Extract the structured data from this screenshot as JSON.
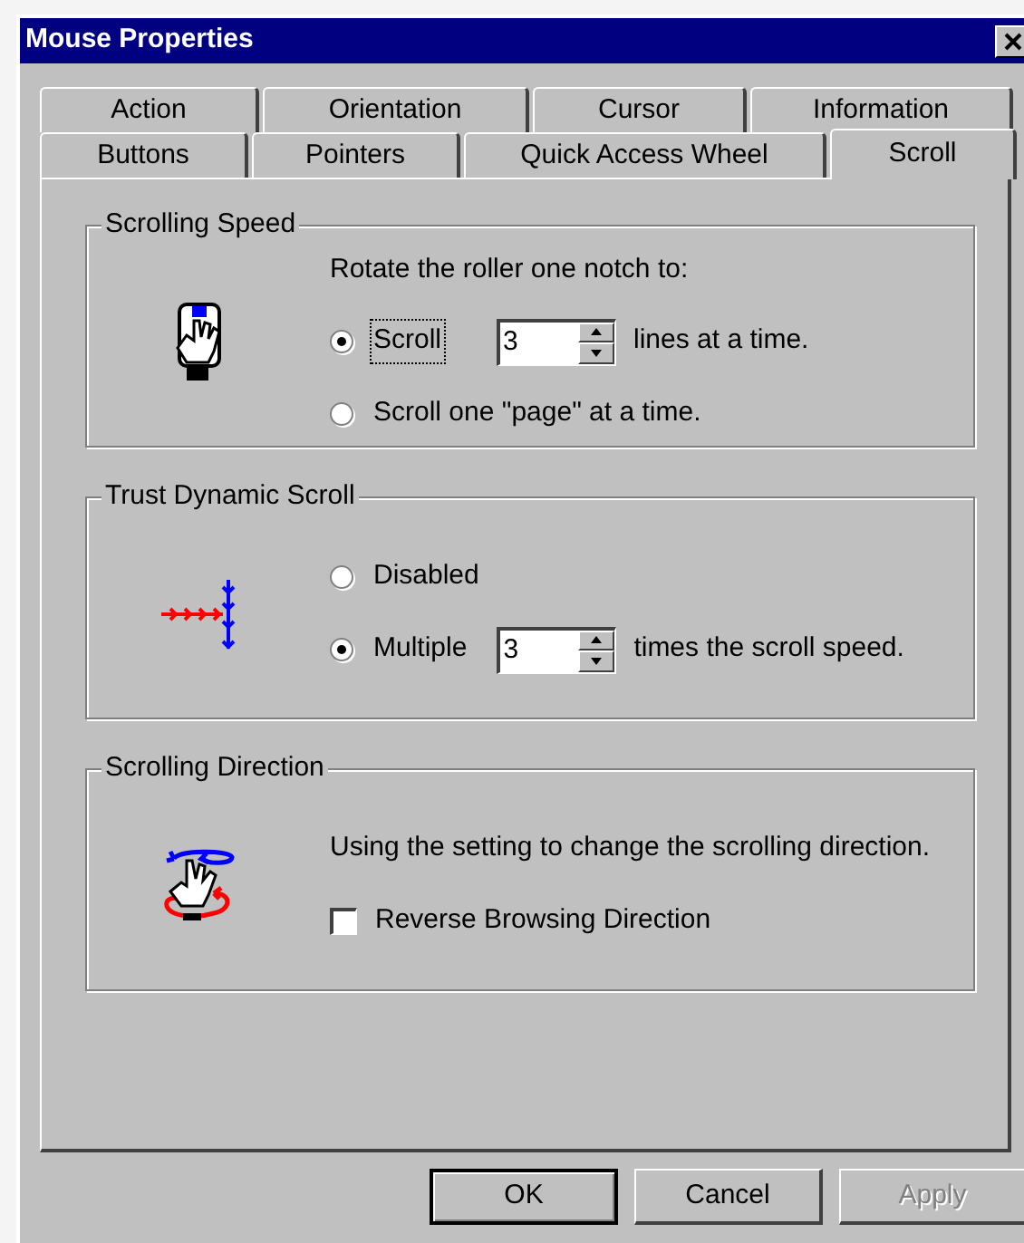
{
  "window": {
    "title": "Mouse Properties"
  },
  "tab_rows": [
    [
      {
        "label": "Action",
        "selected": false
      },
      {
        "label": "Orientation",
        "selected": false
      },
      {
        "label": "Cursor",
        "selected": false
      },
      {
        "label": "Information",
        "selected": false
      }
    ],
    [
      {
        "label": "Buttons",
        "selected": false
      },
      {
        "label": "Pointers",
        "selected": false
      },
      {
        "label": "Quick Access Wheel",
        "selected": false
      },
      {
        "label": "Scroll",
        "selected": true
      }
    ]
  ],
  "groups": [
    {
      "title": "Scrolling Speed",
      "items": [
        {
          "kind": "text",
          "text": "Rotate the roller one notch to:"
        },
        {
          "kind": "radio",
          "label": "Scroll",
          "selected": true,
          "focused": true,
          "spinner": "3",
          "suffix": "lines at a time."
        },
        {
          "kind": "radio",
          "label": "Scroll one \"page\" at a time.",
          "selected": false,
          "focused": false
        }
      ]
    },
    {
      "title": "Trust Dynamic Scroll",
      "items": [
        {
          "kind": "radio",
          "label": "Disabled",
          "selected": false,
          "focused": false
        },
        {
          "kind": "radio",
          "label": "Multiple",
          "selected": true,
          "focused": false,
          "spinner": "3",
          "suffix": "times the scroll speed."
        }
      ]
    },
    {
      "title": "Scrolling Direction",
      "items": [
        {
          "kind": "text",
          "text": "Using the setting to change the scrolling direction."
        },
        {
          "kind": "checkbox",
          "label": "Reverse Browsing Direction",
          "checked": false
        }
      ]
    }
  ],
  "buttons": [
    {
      "label": "OK",
      "default": true,
      "disabled": false
    },
    {
      "label": "Cancel",
      "default": false,
      "disabled": false
    },
    {
      "label": "Apply",
      "default": false,
      "disabled": true
    }
  ]
}
